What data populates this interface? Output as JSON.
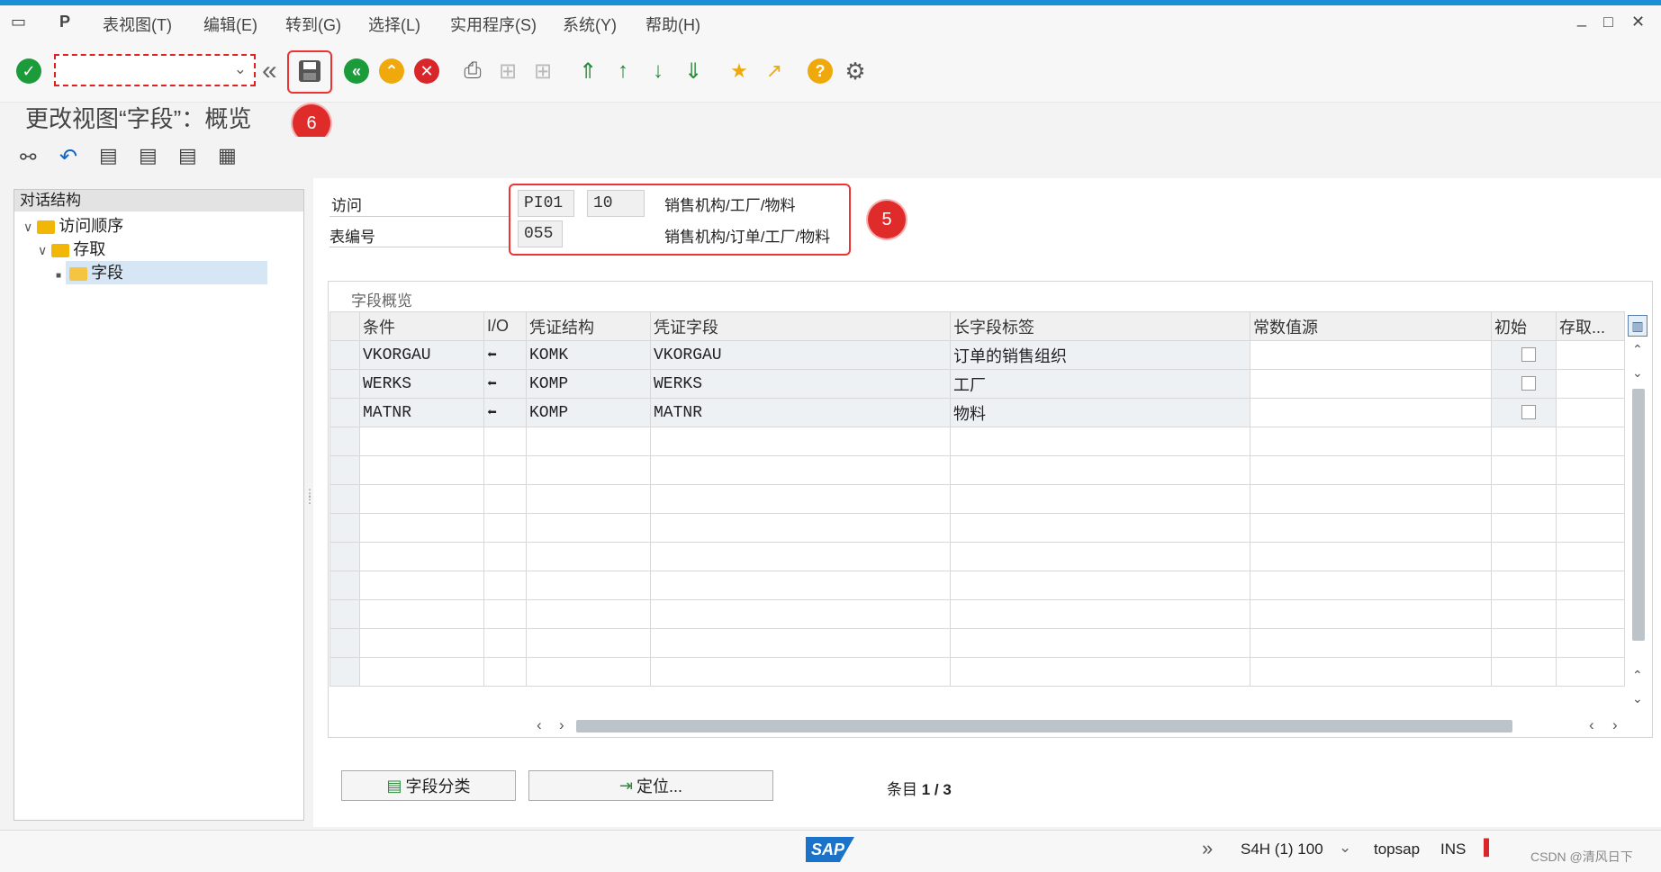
{
  "menu": {
    "items": [
      "表视图(T)",
      "编辑(E)",
      "转到(G)",
      "选择(L)",
      "实用程序(S)",
      "系统(Y)",
      "帮助(H)"
    ]
  },
  "toolbar": {
    "command_value": "",
    "badge_save": "6"
  },
  "page_title": "更改视图“字段”：概览",
  "left_panel": {
    "header": "对话结构",
    "tree": [
      {
        "label": "访问顺序",
        "level": 0
      },
      {
        "label": "存取",
        "level": 1
      },
      {
        "label": "字段",
        "level": 2,
        "selected": true
      }
    ]
  },
  "header_fields": {
    "access_label": "访问",
    "access_value": "PI01",
    "access_seq": "10",
    "access_desc": "销售机构/工厂/物料",
    "table_label": "表编号",
    "table_value": "055",
    "table_desc": "销售机构/订单/工厂/物料",
    "badge": "5"
  },
  "grid": {
    "title": "字段概览",
    "columns": [
      "条件",
      "I/O",
      "凭证结构",
      "凭证字段",
      "长字段标签",
      "常数值源",
      "初始",
      "存取..."
    ],
    "rows": [
      {
        "cond": "VKORGAU",
        "struct": "KOMK",
        "field": "VKORGAU",
        "label": "订单的销售组织"
      },
      {
        "cond": "WERKS",
        "struct": "KOMP",
        "field": "WERKS",
        "label": "工厂"
      },
      {
        "cond": "MATNR",
        "struct": "KOMP",
        "field": "MATNR",
        "label": "物料"
      }
    ]
  },
  "buttons": {
    "field_catalog": "字段分类",
    "position": "定位...",
    "entry_label": "条目",
    "entry_value": "1 / 3"
  },
  "status": {
    "system": "S4H (1) 100",
    "user": "topsap",
    "mode": "INS",
    "watermark": "CSDN @清风日下"
  },
  "colors": {
    "accent": "#1a8fd6",
    "highlight": "#e33333",
    "check_green": "#1b9b3a",
    "nav_orange": "#f0a90c",
    "cancel_red": "#d9262b"
  }
}
